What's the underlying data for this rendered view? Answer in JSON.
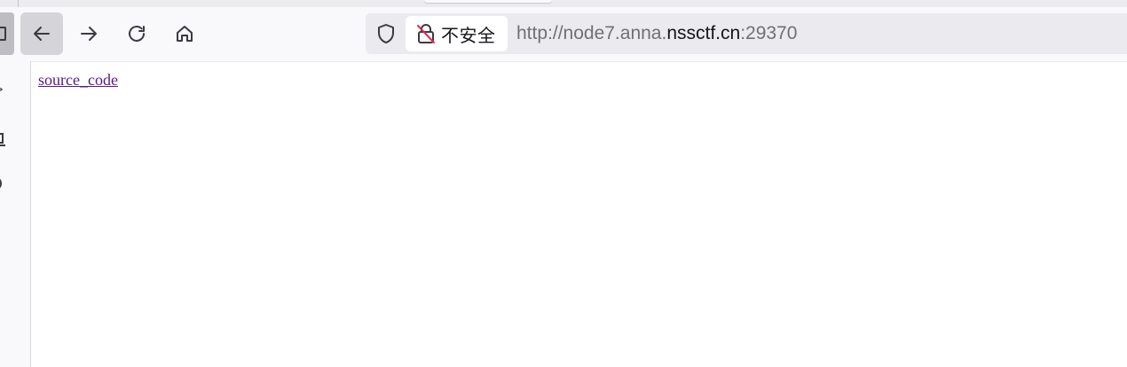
{
  "toolbar": {
    "back_icon": "arrow-left-icon",
    "forward_icon": "arrow-right-icon",
    "reload_icon": "reload-icon",
    "home_icon": "home-icon"
  },
  "urlbar": {
    "security_label": "不安全",
    "url_prefix": "http://node7.anna.",
    "url_domain": "nssctf.cn",
    "url_suffix": ":29370"
  },
  "page": {
    "link_text": "source_code"
  },
  "colors": {
    "link_visited": "#551a8b",
    "insecure_strike": "#e22850",
    "toolbar_bg": "#f9f9fb",
    "urlbar_bg": "#ebebef"
  }
}
